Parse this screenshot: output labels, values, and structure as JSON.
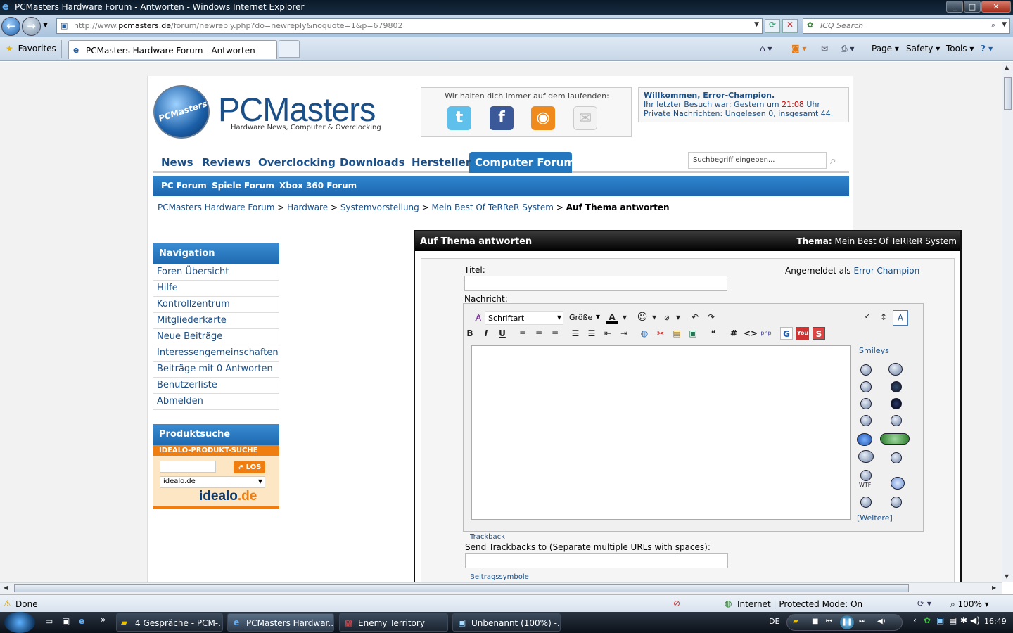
{
  "window": {
    "title": "PCMasters Hardware Forum - Antworten - Windows Internet Explorer"
  },
  "browser": {
    "url_prefix": "http://www.",
    "url_domain": "pcmasters.de",
    "url_rest": "/forum/newreply.php?do=newreply&noquote=1&p=679802",
    "search_placeholder": "ICQ Search",
    "favorites_label": "Favorites",
    "tab_title": "PCMasters Hardware Forum - Antworten",
    "tools": [
      "Page",
      "Safety",
      "Tools"
    ]
  },
  "site": {
    "logo_badge": "PCMasters",
    "logo_title": "PCMasters",
    "logo_subtitle": "Hardware News, Computer & Overclocking",
    "social_heading": "Wir halten dich immer auf dem laufenden:",
    "welcome_title": "Willkommen, Error-Champion.",
    "welcome_last_visit_prefix": "Ihr letzter Besuch war: Gestern um ",
    "welcome_last_visit_time": "21:08",
    "welcome_last_visit_suffix": " Uhr",
    "welcome_pm": "Private Nachrichten: Ungelesen 0, insgesamt 44.",
    "main_nav": [
      "News",
      "Reviews",
      "Overclocking",
      "Downloads",
      "Hersteller",
      "Computer Forum"
    ],
    "sub_nav": [
      "PC Forum",
      "Spiele Forum",
      "Xbox 360 Forum"
    ],
    "search_placeholder": "Suchbegriff eingeben...",
    "breadcrumb": [
      "PCMasters Hardware Forum",
      "Hardware",
      "Systemvorstellung",
      "Mein Best Of TeRReR System"
    ],
    "breadcrumb_current": "Auf Thema antworten",
    "nav_heading": "Navigation",
    "nav_items": [
      "Foren Übersicht",
      "Hilfe",
      "Kontrollzentrum",
      "Mitgliederkarte",
      "Neue Beiträge",
      "Interessengemeinschaften",
      "Beiträge mit 0 Antworten",
      "Benutzerliste",
      "Abmelden"
    ],
    "product_heading": "Produktsuche",
    "idealo_banner": "IDEALO-PRODUKT-SUCHE",
    "idealo_button": "LOS",
    "idealo_select": "idealo.de",
    "idealo_logo_a": "idealo",
    "idealo_logo_b": ".de"
  },
  "reply": {
    "heading": "Auf Thema antworten",
    "thema_label": "Thema:",
    "thema_value": "Mein Best Of TeRReR System",
    "title_label": "Titel:",
    "logged_in_label": "Angemeldet als ",
    "logged_in_user": "Error-Champion",
    "message_label": "Nachricht:",
    "font_select": "Schriftart",
    "size_select": "Größe",
    "smileys_label": "Smileys",
    "more_smileys": "[Weitere]",
    "wtf_label": "WTF",
    "trackback_label": "Trackback",
    "trackback_desc": "Send Trackbacks to (Separate multiple URLs with spaces):",
    "post_icons_label": "Beitragssymbole"
  },
  "status": {
    "text": "Done",
    "zone": "Internet | Protected Mode: On",
    "zoom": "100%"
  },
  "taskbar": {
    "tasks": [
      "4 Gespräche - PCM-...",
      "PCMasters Hardwar...",
      "Enemy Territory",
      "Unbenannt (100%) -..."
    ],
    "lang": "DE",
    "clock": "16:49"
  }
}
